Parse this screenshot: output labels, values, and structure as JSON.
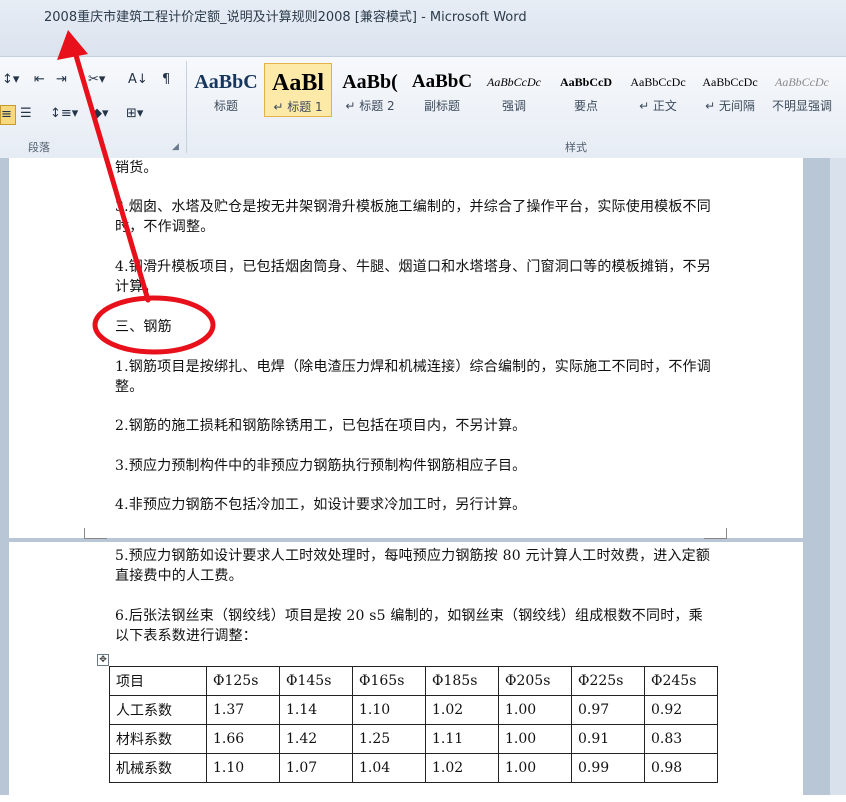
{
  "window": {
    "title": "2008重庆市建筑工程计价定额_说明及计算规则2008 [兼容模式] - Microsoft Word"
  },
  "ribbon": {
    "paragraph_group": {
      "label": "段落",
      "tools": [
        {
          "name": "multilevel-list",
          "glyph": "↕▾"
        },
        {
          "name": "decrease-indent",
          "glyph": "⇤"
        },
        {
          "name": "increase-indent",
          "glyph": "⇥"
        },
        {
          "name": "chinese-layout",
          "glyph": "✂▾"
        },
        {
          "name": "sort",
          "glyph": "A↓"
        },
        {
          "name": "show-marks",
          "glyph": "¶"
        },
        {
          "name": "align-justify",
          "glyph": "≡"
        },
        {
          "name": "distributed",
          "glyph": "☰"
        },
        {
          "name": "line-spacing",
          "glyph": "↕≡▾"
        },
        {
          "name": "shading",
          "glyph": "◆▾"
        },
        {
          "name": "borders",
          "glyph": "⊞▾"
        }
      ]
    },
    "styles_group": {
      "label": "样式",
      "items": [
        {
          "preview": "AaBbC",
          "name": "标题"
        },
        {
          "preview": "AaBl",
          "name": "↵ 标题 1"
        },
        {
          "preview": "AaBb(",
          "name": "↵ 标题 2"
        },
        {
          "preview": "AaBbC",
          "name": "副标题"
        },
        {
          "preview": "AaBbCcDc",
          "name": "强调"
        },
        {
          "preview": "AaBbCcD",
          "name": "要点"
        },
        {
          "preview": "AaBbCcDc",
          "name": "↵ 正文"
        },
        {
          "preview": "AaBbCcDc",
          "name": "↵ 无间隔"
        },
        {
          "preview": "AaBbCcDc",
          "name": "不明显强调"
        }
      ]
    }
  },
  "document": {
    "page1": {
      "top_fragment": "销货。",
      "para3": "3.烟囱、水塔及贮仓是按无井架钢滑升模板施工编制的，并综合了操作平台，实际使用模板不同时，不作调整。",
      "para4": "4.钢滑升模板项目，已包括烟囱筒身、牛腿、烟道口和水塔塔身、门窗洞口等的模板摊销，不另计算。",
      "heading": "三、钢筋",
      "rebar1": "1.钢筋项目是按绑扎、电焊（除电渣压力焊和机械连接）综合编制的，实际施工不同时，不作调整。",
      "rebar2": "2.钢筋的施工损耗和钢筋除锈用工，已包括在项目内，不另计算。",
      "rebar3": "3.预应力预制构件中的非预应力钢筋执行预制构件钢筋相应子目。",
      "rebar4": "4.非预应力钢筋不包括冷加工，如设计要求冷加工时，另行计算。"
    },
    "page2": {
      "rebar5": "5.预应力钢筋如设计要求人工时效处理时，每吨预应力钢筋按 80 元计算人工时效费，进入定额直接费中的人工费。",
      "rebar6": "6.后张法钢丝束（钢绞线）项目是按 20    s5 编制的，如钢丝束（钢绞线）组成根数不同时，乘以下表系数进行调整："
    },
    "coef_table": {
      "header": [
        "项目",
        "Φ125s",
        "Φ145s",
        "Φ165s",
        "Φ185s",
        "Φ205s",
        "Φ225s",
        "Φ245s"
      ],
      "rows": [
        [
          "人工系数",
          "1.37",
          "1.14",
          "1.10",
          "1.02",
          "1.00",
          "0.97",
          "0.92"
        ],
        [
          "材料系数",
          "1.66",
          "1.42",
          "1.25",
          "1.11",
          "1.00",
          "0.91",
          "0.83"
        ],
        [
          "机械系数",
          "1.10",
          "1.07",
          "1.04",
          "1.02",
          "1.00",
          "0.99",
          "0.98"
        ]
      ]
    }
  },
  "annotation": {
    "color": "#e8101a"
  }
}
